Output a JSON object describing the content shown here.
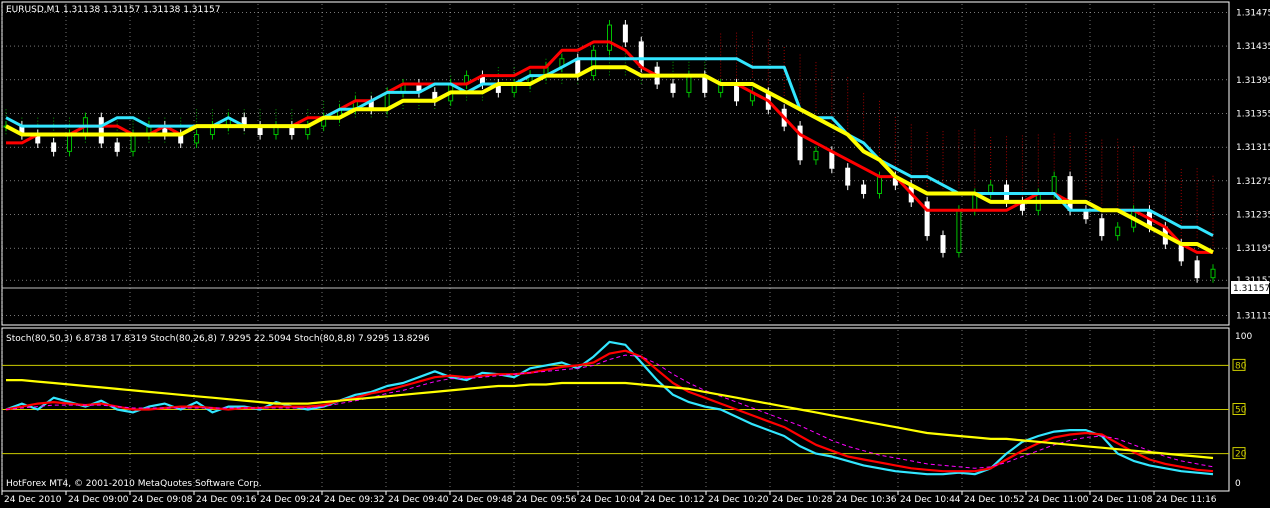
{
  "main_header": "EURUSD,M1  1.31138 1.31157 1.31138 1.31157",
  "sub_header": "Stoch(80,50,3) 6.8738 17.8319  Stoch(80,26,8) 7.9295 22.5094  Stoch(80,8,8) 7.9295 13.8296",
  "watermark": "HotForex MT4, © 2001-2010 MetaQuotes Software Corp.",
  "current_price": "1.31157",
  "colors": {
    "background": "#000000",
    "grid": "#c0c0c0",
    "candle_up": "#00c000",
    "candle_down": "#ffffff",
    "ma_red": "#ff0000",
    "ma_cyan": "#33e6ff",
    "ma_yellow": "#ffff00",
    "thin_yellow": "#e6e62a",
    "cloud_green": "#00a000",
    "cloud_red": "#a00000",
    "stoch_level": "#cccc00",
    "stoch_signal": "#ff00ff"
  },
  "chart_data": [
    {
      "type": "candlestick",
      "symbol": "EURUSD",
      "timeframe": "M1",
      "ylim": [
        1.31105,
        1.31485
      ],
      "y_ticks": [
        "1.31475",
        "1.31435",
        "1.31395",
        "1.31355",
        "1.31315",
        "1.31275",
        "1.31235",
        "1.31195",
        "1.31157",
        "1.31115"
      ],
      "x_ticks": [
        "24 Dec 2010",
        "24 Dec 09:00",
        "24 Dec 09:08",
        "24 Dec 09:16",
        "24 Dec 09:24",
        "24 Dec 09:32",
        "24 Dec 09:40",
        "24 Dec 09:48",
        "24 Dec 09:56",
        "24 Dec 10:04",
        "24 Dec 10:12",
        "24 Dec 10:20",
        "24 Dec 10:28",
        "24 Dec 10:36",
        "24 Dec 10:44",
        "24 Dec 10:52",
        "24 Dec 11:00",
        "24 Dec 11:08",
        "24 Dec 11:16"
      ],
      "series": [
        {
          "style": "close",
          "values": [
            1.3134,
            1.3133,
            1.3132,
            1.3131,
            1.3133,
            1.3135,
            1.3132,
            1.3131,
            1.3133,
            1.3134,
            1.3133,
            1.3132,
            1.3133,
            1.3134,
            1.3135,
            1.3134,
            1.3133,
            1.3134,
            1.3133,
            1.3134,
            1.3135,
            1.3136,
            1.3137,
            1.3136,
            1.3138,
            1.3139,
            1.3138,
            1.3137,
            1.3139,
            1.314,
            1.3139,
            1.3138,
            1.3139,
            1.314,
            1.3141,
            1.3142,
            1.314,
            1.3143,
            1.3146,
            1.3144,
            1.3141,
            1.3139,
            1.3138,
            1.314,
            1.3138,
            1.3139,
            1.3137,
            1.3138,
            1.3136,
            1.3134,
            1.313,
            1.3131,
            1.3129,
            1.3127,
            1.3126,
            1.3128,
            1.3127,
            1.3125,
            1.3121,
            1.3119,
            1.3124,
            1.3126,
            1.3127,
            1.3125,
            1.3124,
            1.3126,
            1.3128,
            1.3124,
            1.3123,
            1.3121,
            1.3122,
            1.3124,
            1.3122,
            1.312,
            1.3118,
            1.3116,
            1.3117
          ]
        },
        {
          "style": "ma_red",
          "values": [
            1.3132,
            1.3132,
            1.3133,
            1.3133,
            1.3133,
            1.3134,
            1.3134,
            1.3134,
            1.3133,
            1.3133,
            1.3134,
            1.3133,
            1.3134,
            1.3134,
            1.3134,
            1.3134,
            1.3134,
            1.3134,
            1.3134,
            1.3135,
            1.3135,
            1.3136,
            1.3137,
            1.3137,
            1.3138,
            1.3139,
            1.3139,
            1.3139,
            1.3139,
            1.3139,
            1.314,
            1.314,
            1.314,
            1.3141,
            1.3141,
            1.3143,
            1.3143,
            1.3144,
            1.3144,
            1.3143,
            1.3141,
            1.314,
            1.314,
            1.314,
            1.314,
            1.3139,
            1.3139,
            1.3138,
            1.3137,
            1.3135,
            1.3133,
            1.3132,
            1.3131,
            1.313,
            1.3129,
            1.3128,
            1.3128,
            1.3126,
            1.3124,
            1.3124,
            1.3124,
            1.3124,
            1.3124,
            1.3124,
            1.3125,
            1.3126,
            1.3126,
            1.3125,
            1.3125,
            1.3124,
            1.3124,
            1.3124,
            1.3123,
            1.3122,
            1.312,
            1.3119,
            1.3119
          ]
        },
        {
          "style": "ma_cyan",
          "values": [
            1.3135,
            1.3134,
            1.3134,
            1.3134,
            1.3134,
            1.3134,
            1.3134,
            1.3135,
            1.3135,
            1.3134,
            1.3134,
            1.3134,
            1.3134,
            1.3134,
            1.3135,
            1.3134,
            1.3134,
            1.3134,
            1.3134,
            1.3134,
            1.3135,
            1.3136,
            1.3136,
            1.3137,
            1.3138,
            1.3138,
            1.3138,
            1.3139,
            1.3139,
            1.3138,
            1.3139,
            1.3139,
            1.3139,
            1.314,
            1.314,
            1.3141,
            1.3142,
            1.3142,
            1.3142,
            1.3142,
            1.3142,
            1.3142,
            1.3142,
            1.3142,
            1.3142,
            1.3142,
            1.3142,
            1.3141,
            1.3141,
            1.3141,
            1.3136,
            1.3135,
            1.3135,
            1.3133,
            1.3132,
            1.313,
            1.3129,
            1.3128,
            1.3128,
            1.3127,
            1.3126,
            1.3126,
            1.3126,
            1.3126,
            1.3126,
            1.3126,
            1.3126,
            1.3124,
            1.3124,
            1.3124,
            1.3124,
            1.3124,
            1.3124,
            1.3123,
            1.3122,
            1.3122,
            1.3121
          ]
        },
        {
          "style": "ma_yellow",
          "values": [
            1.3134,
            1.3133,
            1.3133,
            1.3133,
            1.3133,
            1.3133,
            1.3133,
            1.3133,
            1.3133,
            1.3133,
            1.3133,
            1.3133,
            1.3134,
            1.3134,
            1.3134,
            1.3134,
            1.3134,
            1.3134,
            1.3134,
            1.3134,
            1.3135,
            1.3135,
            1.3136,
            1.3136,
            1.3136,
            1.3137,
            1.3137,
            1.3137,
            1.3138,
            1.3138,
            1.3138,
            1.3139,
            1.3139,
            1.3139,
            1.314,
            1.314,
            1.314,
            1.3141,
            1.3141,
            1.3141,
            1.314,
            1.314,
            1.314,
            1.314,
            1.314,
            1.3139,
            1.3139,
            1.3139,
            1.3138,
            1.3137,
            1.3136,
            1.3135,
            1.3134,
            1.3133,
            1.3131,
            1.313,
            1.3128,
            1.3127,
            1.3126,
            1.3126,
            1.3126,
            1.3126,
            1.3125,
            1.3125,
            1.3125,
            1.3125,
            1.3125,
            1.3125,
            1.3125,
            1.3124,
            1.3124,
            1.3123,
            1.3122,
            1.3121,
            1.312,
            1.312,
            1.3119
          ]
        }
      ]
    },
    {
      "type": "line",
      "title": "Stoch",
      "ylim": [
        0,
        100
      ],
      "y_ticks": [
        "100",
        "80",
        "50",
        "20",
        "0"
      ],
      "levels": [
        80,
        50,
        20
      ],
      "series": [
        {
          "style": "cyan",
          "values": [
            50,
            54,
            50,
            58,
            55,
            52,
            56,
            50,
            48,
            52,
            54,
            50,
            55,
            48,
            52,
            52,
            50,
            55,
            52,
            50,
            52,
            56,
            60,
            62,
            66,
            68,
            72,
            76,
            72,
            70,
            75,
            74,
            72,
            78,
            80,
            82,
            78,
            86,
            96,
            94,
            82,
            70,
            60,
            55,
            52,
            50,
            45,
            40,
            36,
            32,
            25,
            20,
            18,
            15,
            12,
            10,
            8,
            7,
            6,
            6,
            7,
            6,
            10,
            20,
            28,
            32,
            35,
            36,
            36,
            32,
            20,
            15,
            12,
            10,
            8,
            7,
            6
          ]
        },
        {
          "style": "red",
          "values": [
            50,
            52,
            54,
            55,
            54,
            53,
            54,
            52,
            50,
            50,
            51,
            52,
            52,
            51,
            50,
            51,
            51,
            52,
            52,
            52,
            53,
            56,
            58,
            61,
            63,
            66,
            69,
            72,
            73,
            72,
            73,
            74,
            74,
            75,
            77,
            79,
            80,
            82,
            88,
            90,
            86,
            77,
            68,
            62,
            58,
            54,
            50,
            46,
            42,
            38,
            32,
            26,
            22,
            18,
            16,
            14,
            12,
            10,
            9,
            8,
            8,
            8,
            10,
            16,
            22,
            27,
            31,
            33,
            34,
            33,
            27,
            21,
            16,
            13,
            11,
            9,
            8
          ]
        },
        {
          "style": "magenta",
          "values": [
            50,
            51,
            52,
            53,
            53,
            53,
            53,
            52,
            51,
            51,
            51,
            51,
            51,
            51,
            51,
            51,
            51,
            51,
            51,
            51,
            52,
            54,
            56,
            58,
            61,
            63,
            66,
            69,
            71,
            71,
            72,
            73,
            74,
            75,
            76,
            77,
            78,
            80,
            84,
            87,
            86,
            81,
            74,
            68,
            63,
            59,
            55,
            51,
            47,
            43,
            39,
            34,
            29,
            25,
            22,
            19,
            17,
            15,
            13,
            12,
            11,
            10,
            11,
            14,
            18,
            22,
            26,
            29,
            31,
            32,
            30,
            26,
            22,
            18,
            15,
            13,
            11
          ]
        },
        {
          "style": "yellow",
          "values": [
            70,
            70,
            69,
            68,
            67,
            66,
            65,
            64,
            63,
            62,
            61,
            60,
            59,
            58,
            57,
            56,
            55,
            54,
            54,
            54,
            55,
            56,
            57,
            58,
            59,
            60,
            61,
            62,
            63,
            64,
            65,
            66,
            66,
            67,
            67,
            68,
            68,
            68,
            68,
            68,
            67,
            66,
            65,
            64,
            62,
            60,
            58,
            56,
            54,
            52,
            50,
            48,
            46,
            44,
            42,
            40,
            38,
            36,
            34,
            33,
            32,
            31,
            30,
            30,
            29,
            28,
            27,
            26,
            25,
            24,
            23,
            22,
            21,
            20,
            19,
            18,
            17
          ]
        }
      ]
    }
  ]
}
